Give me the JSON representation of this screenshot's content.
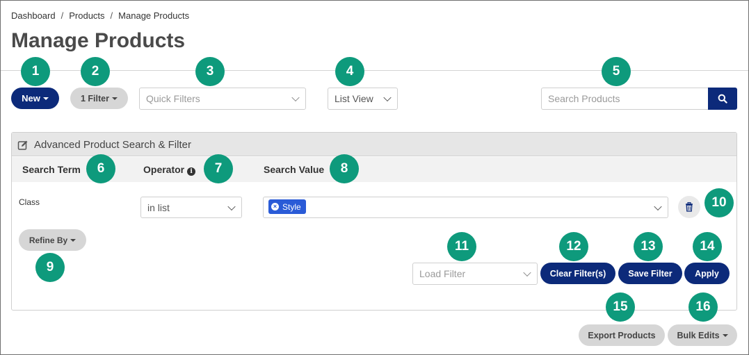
{
  "breadcrumb": {
    "items": [
      "Dashboard",
      "Products",
      "Manage Products"
    ],
    "separator": "/"
  },
  "page": {
    "title": "Manage Products"
  },
  "toolbar": {
    "new_label": "New",
    "filter_count_label": "1 Filter",
    "quick_filters_placeholder": "Quick Filters",
    "view_select_value": "List View",
    "search_placeholder": "Search Products"
  },
  "panel": {
    "title": "Advanced Product Search & Filter",
    "columns": {
      "search_term": "Search Term",
      "operator": "Operator",
      "search_value": "Search Value"
    },
    "row": {
      "term": "Class",
      "operator_value": "in list",
      "values": [
        "Style"
      ]
    },
    "refine_by_label": "Refine By",
    "load_filter_placeholder": "Load Filter",
    "clear_label": "Clear Filter(s)",
    "save_label": "Save Filter",
    "apply_label": "Apply"
  },
  "footer": {
    "export_label": "Export Products",
    "bulk_edits_label": "Bulk Edits"
  },
  "callouts": [
    "1",
    "2",
    "3",
    "4",
    "5",
    "6",
    "7",
    "8",
    "9",
    "10",
    "11",
    "12",
    "13",
    "14",
    "15",
    "16"
  ],
  "colors": {
    "primary_navy": "#0c2a7a",
    "callout_green": "#0e9a7c",
    "tag_blue": "#2a5bd7",
    "secondary_grey": "#d6d6d6"
  }
}
